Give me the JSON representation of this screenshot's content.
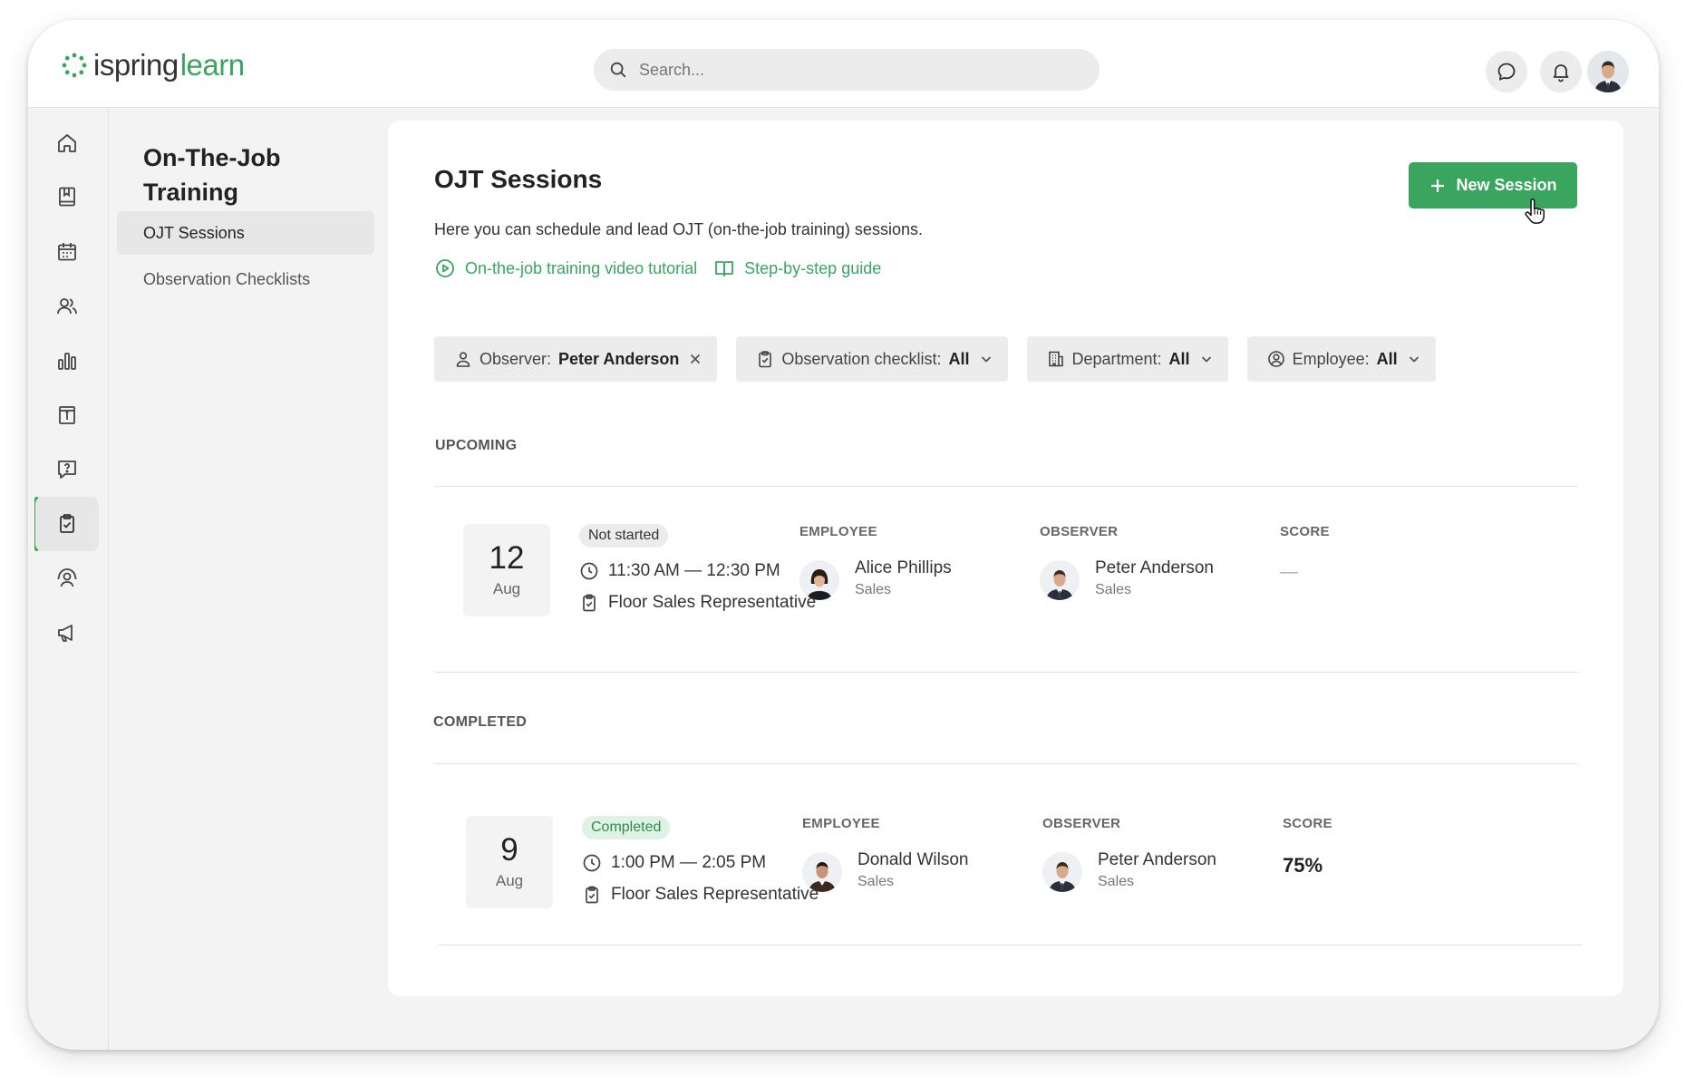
{
  "brand": {
    "name_part1": "ispring",
    "name_part2": "learn",
    "accent": "#3aa55f"
  },
  "search": {
    "placeholder": "Search..."
  },
  "topbar_icons": [
    "chat-bubble-icon",
    "bell-icon",
    "user-avatar"
  ],
  "rail": {
    "items": [
      "home",
      "courses",
      "calendar",
      "users",
      "reports",
      "info",
      "help-questions",
      "ojt-checklist",
      "supervisor",
      "announcements"
    ],
    "active": "ojt-checklist"
  },
  "subnav": {
    "title": "On-The-Job Training",
    "items": [
      {
        "label": "OJT Sessions",
        "active": true
      },
      {
        "label": "Observation Checklists",
        "active": false
      }
    ]
  },
  "main": {
    "title": "OJT Sessions",
    "new_button": "New Session",
    "description": "Here you can schedule and lead OJT (on-the-job training) sessions.",
    "links": {
      "video": "On-the-job training video tutorial",
      "guide": "Step-by-step guide"
    },
    "filters": {
      "observer": {
        "label": "Observer:",
        "value": "Peter Anderson"
      },
      "checklist": {
        "label": "Observation checklist:",
        "value": "All"
      },
      "department": {
        "label": "Department:",
        "value": "All"
      },
      "employee": {
        "label": "Employee:",
        "value": "All"
      }
    },
    "columns": {
      "employee": "EMPLOYEE",
      "observer": "OBSERVER",
      "score": "SCORE"
    },
    "upcoming": {
      "label": "UPCOMING",
      "session": {
        "day": "12",
        "month": "Aug",
        "status": "Not started",
        "time": "11:30 AM — 12:30 PM",
        "checklist": "Floor Sales Representative",
        "employee": {
          "name": "Alice Phillips",
          "department": "Sales"
        },
        "observer": {
          "name": "Peter Anderson",
          "department": "Sales"
        },
        "score": "—"
      }
    },
    "completed": {
      "label": "COMPLETED",
      "session": {
        "day": "9",
        "month": "Aug",
        "status": "Completed",
        "time": "1:00 PM — 2:05 PM",
        "checklist": "Floor Sales Representative",
        "employee": {
          "name": "Donald Wilson",
          "department": "Sales"
        },
        "observer": {
          "name": "Peter Anderson",
          "department": "Sales"
        },
        "score": "75%"
      }
    }
  }
}
